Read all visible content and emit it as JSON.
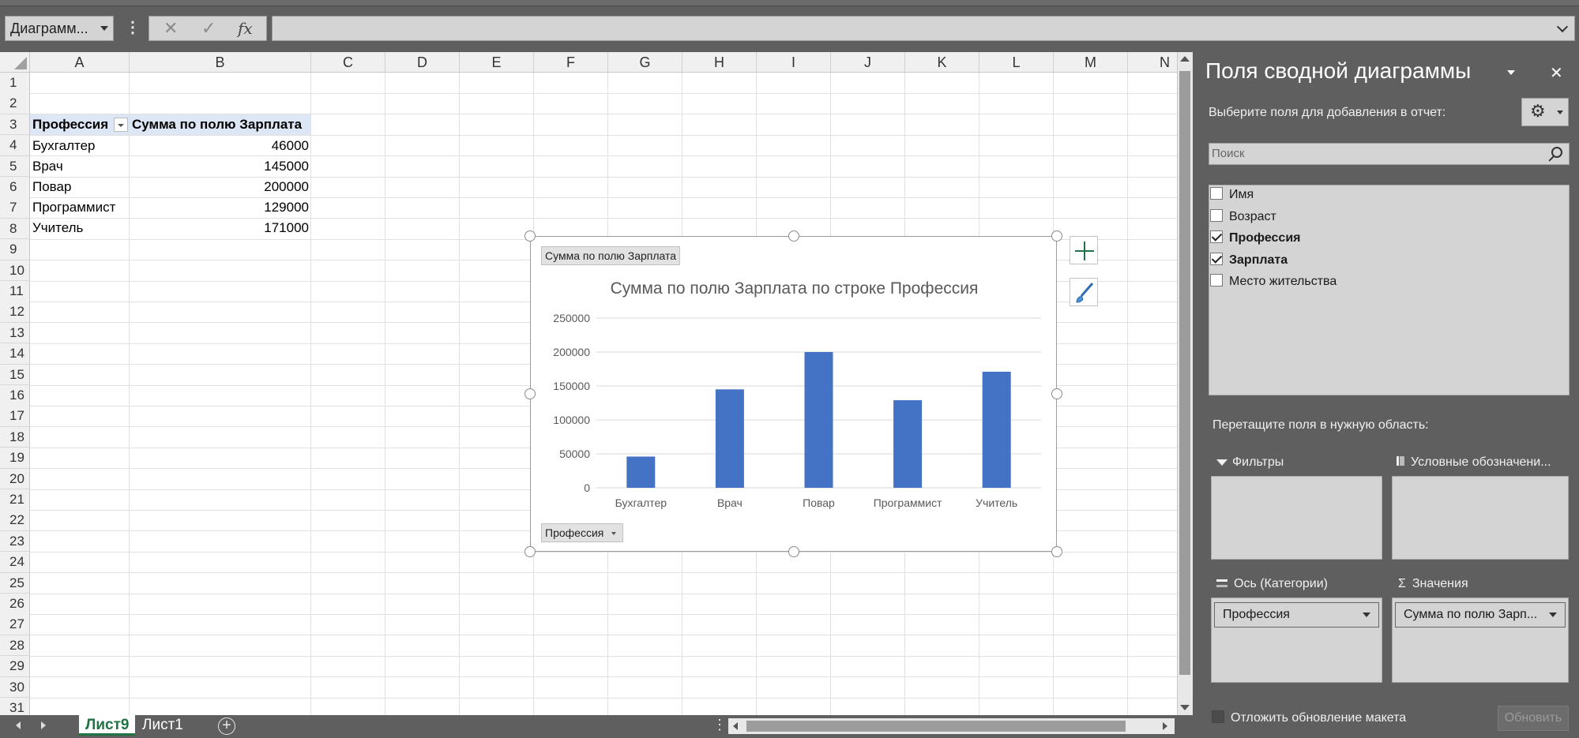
{
  "formula_bar": {
    "name_box": "Диаграмм...",
    "cancel_symbol": "✕",
    "enter_symbol": "✓",
    "fx_label": "fx",
    "formula": ""
  },
  "columns": [
    "A",
    "B",
    "C",
    "D",
    "E",
    "F",
    "G",
    "H",
    "I",
    "J",
    "K",
    "L",
    "M",
    "N"
  ],
  "rows": [
    "1",
    "2",
    "3",
    "4",
    "5",
    "6",
    "7",
    "8",
    "9",
    "10",
    "11",
    "12",
    "13",
    "14",
    "15",
    "16",
    "17",
    "18",
    "19",
    "20",
    "21",
    "22",
    "23",
    "24",
    "25",
    "26",
    "27",
    "28",
    "29",
    "30",
    "31"
  ],
  "pivot": {
    "header_row": [
      "Профессия",
      "Сумма по полю Зарплата"
    ],
    "rows": [
      [
        "Бухгалтер",
        "46000"
      ],
      [
        "Врач",
        "145000"
      ],
      [
        "Повар",
        "200000"
      ],
      [
        "Программист",
        "129000"
      ],
      [
        "Учитель",
        "171000"
      ]
    ]
  },
  "sheet_tabs": {
    "active": "Лист9",
    "other": "Лист1",
    "add_symbol": "+"
  },
  "chart_buttons": {
    "values_field": "Сумма  по полю Зарплата",
    "axis_field": "Профессия"
  },
  "chart_data": {
    "type": "bar",
    "title": "Сумма по полю Зарплата по строке Профессия",
    "categories": [
      "Бухгалтер",
      "Врач",
      "Повар",
      "Программист",
      "Учитель"
    ],
    "values": [
      46000,
      145000,
      200000,
      129000,
      171000
    ],
    "ylim": [
      0,
      250000
    ],
    "yticks": [
      "0",
      "50000",
      "100000",
      "150000",
      "200000",
      "250000"
    ],
    "xlabel": "",
    "ylabel": "",
    "grid": true,
    "legend": "none",
    "bar_color": "#4472c4"
  },
  "pane": {
    "title": "Поля сводной диаграммы",
    "close_symbol": "✕",
    "subtitle": "Выберите поля для добавления в отчет:",
    "settings_icon": "⚙",
    "search_placeholder": "Поиск",
    "fields": [
      {
        "label": "Имя",
        "checked": false
      },
      {
        "label": "Возраст",
        "checked": false
      },
      {
        "label": "Профессия",
        "checked": true
      },
      {
        "label": "Зарплата",
        "checked": true
      },
      {
        "label": "Место жительства",
        "checked": false
      }
    ],
    "drag_hint": "Перетащите поля в нужную область:",
    "areas": {
      "filters": "Фильтры",
      "legend": "Условные обозначени...",
      "axis": "Ось (Категории)",
      "values": "Значения",
      "axis_item": "Профессия",
      "values_item": "Сумма по полю Зарп..."
    },
    "defer_label": "Отложить обновление макета",
    "update_button": "Обновить"
  },
  "accent_color": "#217346"
}
